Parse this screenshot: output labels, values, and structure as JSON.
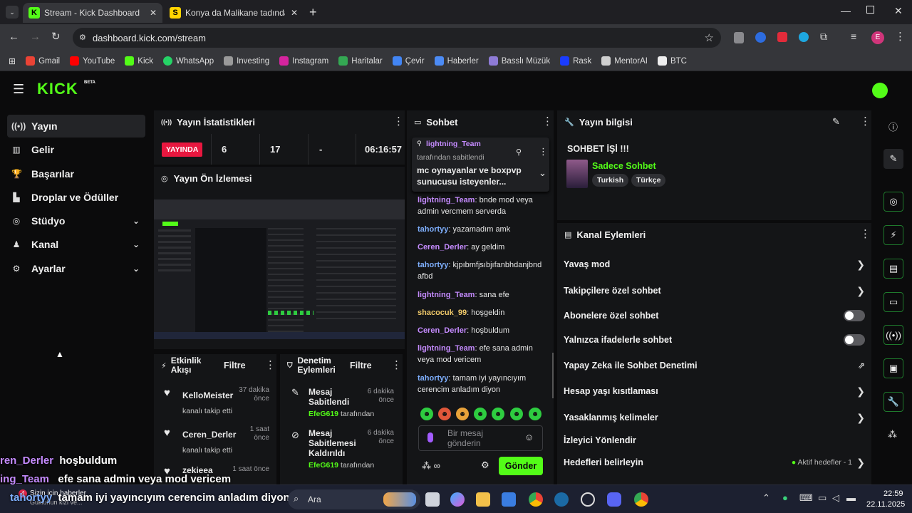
{
  "browser": {
    "tabs": [
      {
        "title": "Stream - Kick Dashboard",
        "active": true
      },
      {
        "title": "Konya da Malikane tadında mü",
        "active": false
      }
    ],
    "url": "dashboard.kick.com/stream",
    "profile_initial": "E",
    "bookmarks": [
      "Gmail",
      "YouTube",
      "Kick",
      "WhatsApp",
      "Investing",
      "Instagram",
      "Haritalar",
      "Çevir",
      "Haberler",
      "Basslı Müzük",
      "Rask",
      "MentorAI",
      "BTC"
    ]
  },
  "app": {
    "logo": "KICK",
    "logo_badge": "BETA",
    "sidebar": [
      {
        "label": "Yayın",
        "icon": "broadcast-icon",
        "active": true
      },
      {
        "label": "Gelir",
        "icon": "revenue-icon"
      },
      {
        "label": "Başarılar",
        "icon": "trophy-icon"
      },
      {
        "label": "Droplar ve Ödüller",
        "icon": "drops-icon"
      },
      {
        "label": "Stüdyo",
        "icon": "studio-icon",
        "expandable": true
      },
      {
        "label": "Kanal",
        "icon": "channel-icon",
        "expandable": true
      },
      {
        "label": "Ayarlar",
        "icon": "gear-icon",
        "expandable": true
      }
    ],
    "stats": {
      "title": "Yayın İstatistikleri",
      "live_badge": "YAYINDA",
      "values": [
        "6",
        "17",
        "-",
        "06:16:57"
      ]
    },
    "preview": {
      "title": "Yayın Ön İzlemesi"
    },
    "activity": {
      "title": "Etkinlik Akışı",
      "filter": "Filtre",
      "items": [
        {
          "user": "KelloMeister",
          "time": "37 dakika önce",
          "text": "kanalı takip etti"
        },
        {
          "user": "Ceren_Derler",
          "time": "1 saat önce",
          "text": "kanalı takip etti"
        },
        {
          "user": "zekieea",
          "time": "1 saat önce",
          "text": ""
        }
      ]
    },
    "moderation": {
      "title": "Denetim Eylemleri",
      "filter": "Filtre",
      "items": [
        {
          "title": "Mesaj Sabitlendi",
          "user": "EfeG619",
          "by": "tarafından",
          "time": "6 dakika önce"
        },
        {
          "title": "Mesaj Sabitlemesi Kaldırıldı",
          "user": "EfeG619",
          "by": "tarafından",
          "time": "6 dakika önce"
        }
      ]
    },
    "chat": {
      "title": "Sohbet",
      "pinned": {
        "user": "lightning_Team",
        "by": "tarafından sabitlendi",
        "text": "mc oynayanlar ve boxpvp sunucusu isteyenler..."
      },
      "messages": [
        {
          "user": "lightning_Team",
          "color": "#c58bff",
          "text": "bnde mod veya admin vercmem serverda"
        },
        {
          "user": "tahortyy",
          "color": "#7fb0ff",
          "text": "yazamadım amk"
        },
        {
          "user": "Ceren_Derler",
          "color": "#c58bff",
          "text": "ay geldim"
        },
        {
          "user": "tahortyy",
          "color": "#7fb0ff",
          "text": "kjpıbmfjsıbjıfanbhdanjbndafbd"
        },
        {
          "user": "lightning_Team",
          "color": "#c58bff",
          "text": "sana efe"
        },
        {
          "user": "shacocuk_99",
          "color": "#f0c96a",
          "text": "hoşgeldin"
        },
        {
          "user": "Ceren_Derler",
          "color": "#c58bff",
          "text": "hoşbuldum"
        },
        {
          "user": "lightning_Team",
          "color": "#c58bff",
          "text": "efe sana admin veya mod vericem"
        },
        {
          "user": "tahortyy",
          "color": "#7fb0ff",
          "text": "tamam iyi yayıncıyım cerencim anladım diyon"
        }
      ],
      "input_placeholder": "Bir mesaj gönderin",
      "send_label": "Gönder"
    },
    "stream_info": {
      "title": "Yayın bilgisi",
      "stream_title": "SOHBET İŞİ !!!",
      "category": "Sadece Sohbet",
      "tags": [
        "Turkish",
        "Türkçe"
      ]
    },
    "channel_actions": {
      "title": "Kanal Eylemleri",
      "items": [
        {
          "label": "Yavaş mod",
          "control": "chevron"
        },
        {
          "label": "Takipçilere özel sohbet",
          "control": "chevron"
        },
        {
          "label": "Abonelere özel sohbet",
          "control": "toggle"
        },
        {
          "label": "Yalnızca ifadelerle sohbet",
          "control": "toggle"
        },
        {
          "label": "Yapay Zeka ile Sohbet Denetimi",
          "control": "external"
        },
        {
          "label": "Hesap yaşı kısıtlaması",
          "control": "chevron"
        },
        {
          "label": "Yasaklanmış kelimeler",
          "control": "chevron"
        },
        {
          "label": "İzleyici Yönlendir",
          "control": "none"
        },
        {
          "label": "Hedefleri belirleyin",
          "control": "chevron",
          "extra": "Aktif hedefler - 1"
        }
      ]
    }
  },
  "overlay": {
    "lines": [
      {
        "user": "ren_Derler",
        "text": "hoşbuldum"
      },
      {
        "user": "ing_Team",
        "text": "efe sana admin veya mod vericem"
      },
      {
        "user": "tahortyy",
        "text": "tamam iyi yayıncıyım cerencim anladım diyon"
      }
    ]
  },
  "taskbar": {
    "news_title": "Sizin için haberler",
    "news_sub": "Gukluhun kizi ve...",
    "search": "Ara",
    "time": "22:59",
    "date": "22.11.2025"
  },
  "colors": {
    "kick_green": "#53fc18",
    "live_red": "#e8173f"
  }
}
